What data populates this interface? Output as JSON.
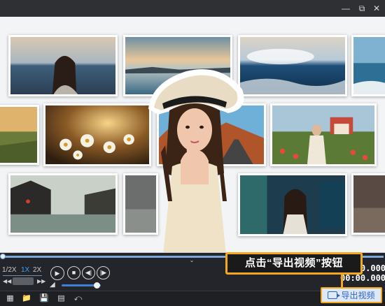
{
  "window": {
    "minimize_icon": "minimize-icon",
    "restore_icon": "restore-icon",
    "close_icon": "close-icon"
  },
  "stage": {
    "photos": [
      {
        "subject": "woman by the sea"
      },
      {
        "subject": "sunset over calm lake"
      },
      {
        "subject": "ocean waves under clouds"
      },
      {
        "subject": "ocean shore"
      },
      {
        "subject": "countryside fields at dusk"
      },
      {
        "subject": "daisy flowers at sunset"
      },
      {
        "subject": "desert road canyon"
      },
      {
        "subject": "girl in flower field with house"
      },
      {
        "subject": "traditional water town"
      },
      {
        "subject": "old street"
      },
      {
        "subject": "woman in neon alley"
      },
      {
        "subject": "street at dusk"
      }
    ],
    "foreground": {
      "subject": "girl in straw hat cutout"
    }
  },
  "playback": {
    "speeds": [
      "1/2X",
      "1X",
      "2X"
    ],
    "active_speed": "1X",
    "play_icon": "play-icon",
    "stop_icon": "stop-icon",
    "prev_icon": "previous-icon",
    "next_icon": "next-icon",
    "rewind_icon": "rewind-icon",
    "forward_icon": "fast-forward-icon",
    "volume_icon": "volume-icon",
    "volume_level": 0.9,
    "progress": 0.0,
    "current_time": "00:00.000",
    "total_time": "00:00.000"
  },
  "toolbar": {
    "icons": [
      "new-project-icon",
      "open-folder-icon",
      "save-icon",
      "save-as-icon",
      "share-icon"
    ],
    "export_label": "导出视频",
    "export_icon": "export-video-icon"
  },
  "annotation": {
    "callout_text": "点击“导出视频”按钮"
  },
  "colors": {
    "accent": "#3aa2ff",
    "highlight": "#f3a91e",
    "stage_bg": "#f3f4f6",
    "panel_bg": "#24252a"
  }
}
